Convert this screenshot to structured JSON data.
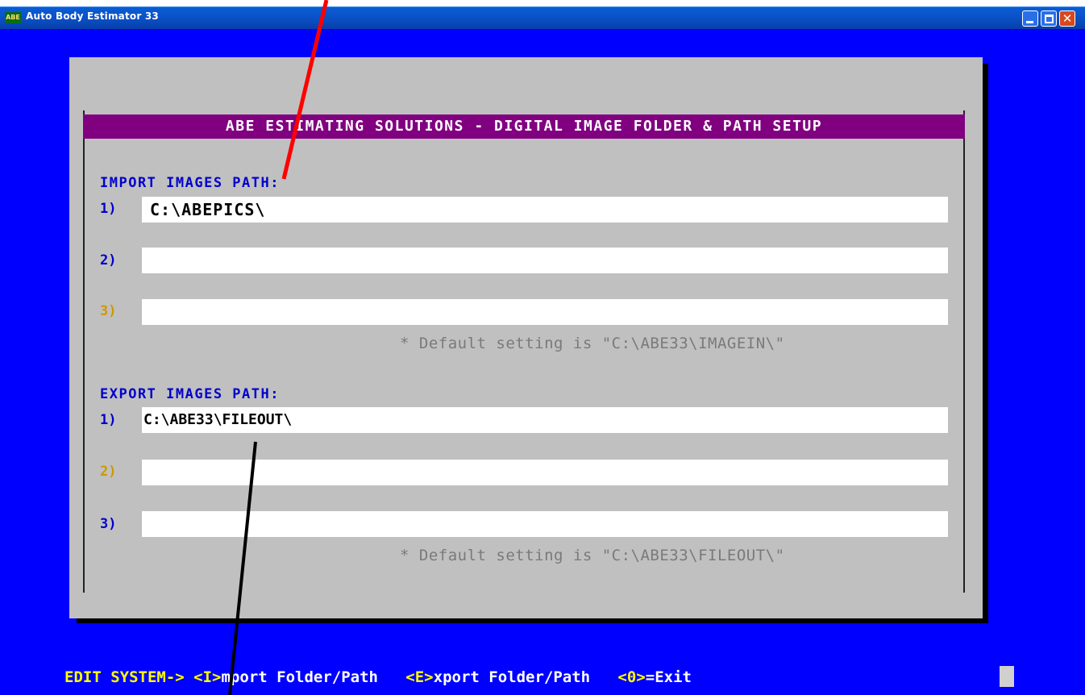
{
  "window": {
    "title": "Auto Body Estimator 33",
    "icon_text": "ABE",
    "colors": {
      "titlebar": "#0a55d0",
      "console_bg": "#0000fe",
      "panel_bg": "#c0c0c0",
      "header_bg": "#800080"
    }
  },
  "panel": {
    "header": "ABE ESTIMATING SOLUTIONS - DIGITAL IMAGE FOLDER & PATH SETUP",
    "import": {
      "label": "IMPORT IMAGES PATH:",
      "rows": [
        {
          "num": "1)",
          "value": "C:\\ABEPICS\\"
        },
        {
          "num": "2)",
          "value": ""
        },
        {
          "num": "3)",
          "value": ""
        }
      ],
      "note": "* Default setting is \"C:\\ABE33\\IMAGEIN\\\""
    },
    "export": {
      "label": "EXPORT IMAGES PATH:",
      "rows": [
        {
          "num": "1)",
          "value": "C:\\ABE33\\FILEOUT\\"
        },
        {
          "num": "2)",
          "value": ""
        },
        {
          "num": "3)",
          "value": ""
        }
      ],
      "note": "* Default setting is \"C:\\ABE33\\FILEOUT\\\""
    }
  },
  "commands": {
    "prefix": "EDIT SYSTEM->",
    "import_key": "<I>",
    "import_text": "mport Folder/Path",
    "export_key": "<E>",
    "export_text": "xport Folder/Path",
    "exit_key": "<0>",
    "exit_text": "=Exit"
  }
}
